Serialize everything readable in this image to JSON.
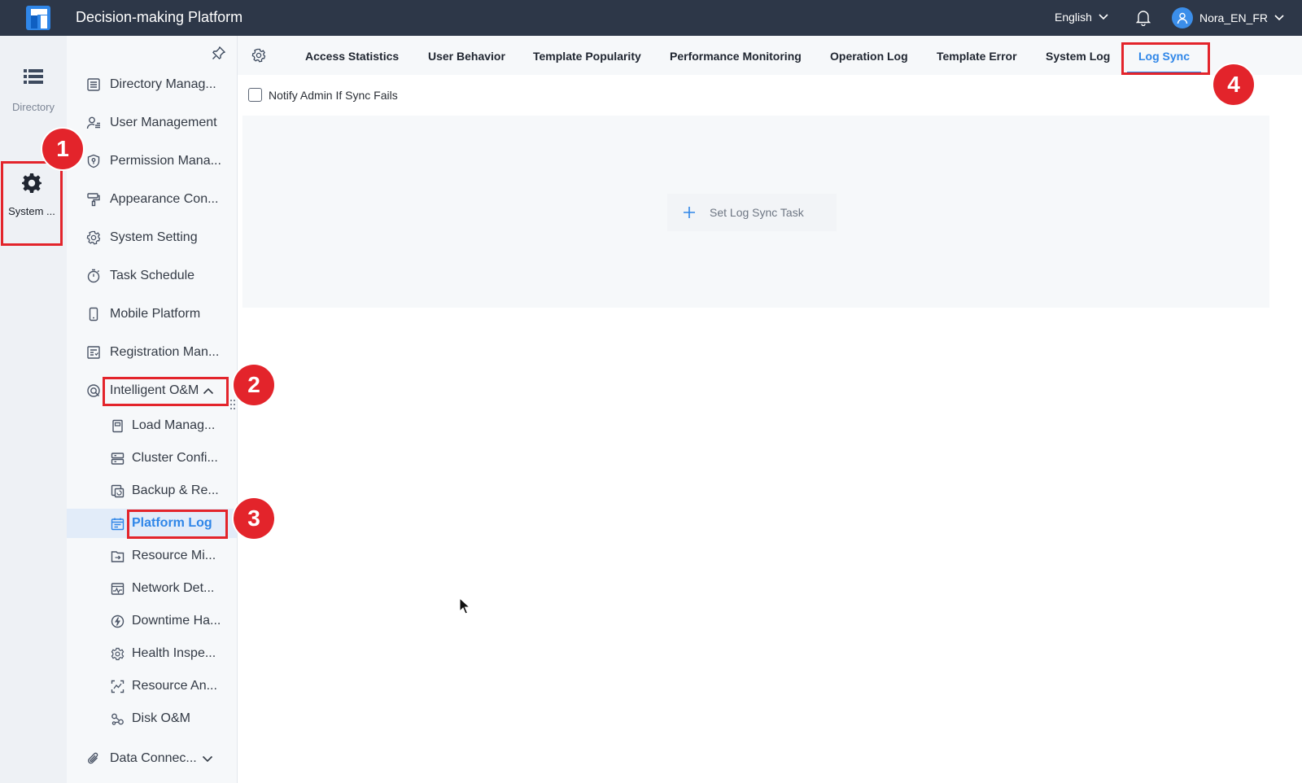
{
  "header": {
    "app_title": "Decision-making Platform",
    "language": "English",
    "username": "Nora_EN_FR",
    "brand_color": "#2d3748"
  },
  "rail": {
    "items": [
      {
        "label": "Directory",
        "icon": "list-icon"
      },
      {
        "label": "System ...",
        "icon": "gear-icon",
        "selected": true
      }
    ]
  },
  "sidebar": {
    "items": [
      {
        "label": "Directory Manag...",
        "icon": "directory-icon"
      },
      {
        "label": "User Management",
        "icon": "user-list-icon"
      },
      {
        "label": "Permission Mana...",
        "icon": "shield-icon"
      },
      {
        "label": "Appearance Con...",
        "icon": "paint-roller-icon"
      },
      {
        "label": "System Setting",
        "icon": "gear-icon"
      },
      {
        "label": "Task Schedule",
        "icon": "timer-icon"
      },
      {
        "label": "Mobile Platform",
        "icon": "mobile-icon"
      },
      {
        "label": "Registration Man...",
        "icon": "registration-icon"
      },
      {
        "label": "Intelligent O&M",
        "icon": "om-icon",
        "expanded": true
      }
    ],
    "subitems": [
      {
        "label": "Load Manag...",
        "icon": "load-icon"
      },
      {
        "label": "Cluster Confi...",
        "icon": "cluster-icon"
      },
      {
        "label": "Backup & Re...",
        "icon": "backup-icon"
      },
      {
        "label": "Platform Log",
        "icon": "calendar-icon",
        "active": true
      },
      {
        "label": "Resource Mi...",
        "icon": "migrate-icon"
      },
      {
        "label": "Network Det...",
        "icon": "network-icon"
      },
      {
        "label": "Downtime Ha...",
        "icon": "lightning-icon"
      },
      {
        "label": "Health Inspe...",
        "icon": "health-icon"
      },
      {
        "label": "Resource An...",
        "icon": "analysis-icon"
      },
      {
        "label": "Disk O&M",
        "icon": "disk-icon"
      }
    ],
    "data_connection": {
      "label": "Data Connec...",
      "icon": "paperclip-icon"
    }
  },
  "tabs": [
    {
      "label": "Access Statistics"
    },
    {
      "label": "User Behavior"
    },
    {
      "label": "Template Popularity"
    },
    {
      "label": "Performance Monitoring"
    },
    {
      "label": "Operation Log"
    },
    {
      "label": "Template Error"
    },
    {
      "label": "System Log"
    },
    {
      "label": "Log Sync",
      "active": true
    }
  ],
  "main": {
    "notify_label": "Notify Admin If Sync Fails",
    "notify_checked": false,
    "set_task_label": "Set Log Sync Task"
  },
  "annotations": {
    "badges": [
      "1",
      "2",
      "3",
      "4"
    ],
    "color": "#e3242b"
  },
  "accent_color": "#2f86e8"
}
